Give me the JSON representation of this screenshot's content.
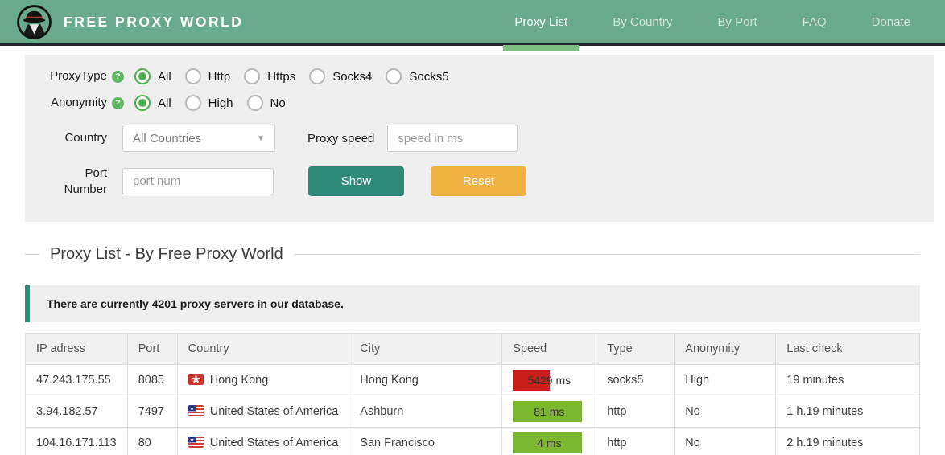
{
  "header": {
    "brand": "FREE PROXY WORLD",
    "nav": [
      {
        "label": "Proxy List",
        "active": true
      },
      {
        "label": "By Country",
        "active": false
      },
      {
        "label": "By Port",
        "active": false
      },
      {
        "label": "FAQ",
        "active": false
      },
      {
        "label": "Donate",
        "active": false
      }
    ]
  },
  "icons": {
    "help": "?",
    "caret": "▼"
  },
  "filters": {
    "proxy_type": {
      "label": "ProxyType",
      "options": [
        {
          "label": "All",
          "checked": true
        },
        {
          "label": "Http",
          "checked": false
        },
        {
          "label": "Https",
          "checked": false
        },
        {
          "label": "Socks4",
          "checked": false
        },
        {
          "label": "Socks5",
          "checked": false
        }
      ]
    },
    "anonymity": {
      "label": "Anonymity",
      "options": [
        {
          "label": "All",
          "checked": true
        },
        {
          "label": "High",
          "checked": false
        },
        {
          "label": "No",
          "checked": false
        }
      ]
    },
    "country": {
      "label": "Country",
      "value": "All Countries"
    },
    "proxy_speed": {
      "label": "Proxy speed",
      "placeholder": "speed in ms"
    },
    "port": {
      "label": "Port Number",
      "placeholder": "port num"
    },
    "show_button": "Show",
    "reset_button": "Reset"
  },
  "section": {
    "title": "Proxy List - By Free Proxy World"
  },
  "alert": {
    "text": "There are currently 4201 proxy servers in our database."
  },
  "table": {
    "headers": [
      "IP adress",
      "Port",
      "Country",
      "City",
      "Speed",
      "Type",
      "Anonymity",
      "Last check"
    ],
    "rows": [
      {
        "ip": "47.243.175.55",
        "port": "8085",
        "country": "Hong Kong",
        "flag": "hk",
        "city": "Hong Kong",
        "speed": "5429 ms",
        "speed_style": "width:46px;background:#cb2019",
        "type": "socks5",
        "anonymity": "High",
        "last_check": "19 minutes"
      },
      {
        "ip": "3.94.182.57",
        "port": "7497",
        "country": "United States of America",
        "flag": "us",
        "city": "Ashburn",
        "speed": "81 ms",
        "speed_style": "width:86px;background:#7cb82f",
        "type": "http",
        "anonymity": "No",
        "last_check": "1 h.19 minutes"
      },
      {
        "ip": "104.16.171.113",
        "port": "80",
        "country": "United States of America",
        "flag": "us",
        "city": "San Francisco",
        "speed": "4 ms",
        "speed_style": "width:86px;background:#7cb82f",
        "type": "http",
        "anonymity": "No",
        "last_check": "2 h.19 minutes"
      }
    ]
  },
  "colors": {
    "header_background": "#69aa8c",
    "active_tab_underline": "#7cbc7e",
    "header_bottom_border": "#20262d",
    "show_button": "#2e8b78",
    "reset_button": "#f0b143",
    "alert_border": "#2e8b78",
    "speed_fast": "#7cb82f",
    "speed_slow": "#cb2019",
    "radio_checked": "#4cae4c"
  }
}
